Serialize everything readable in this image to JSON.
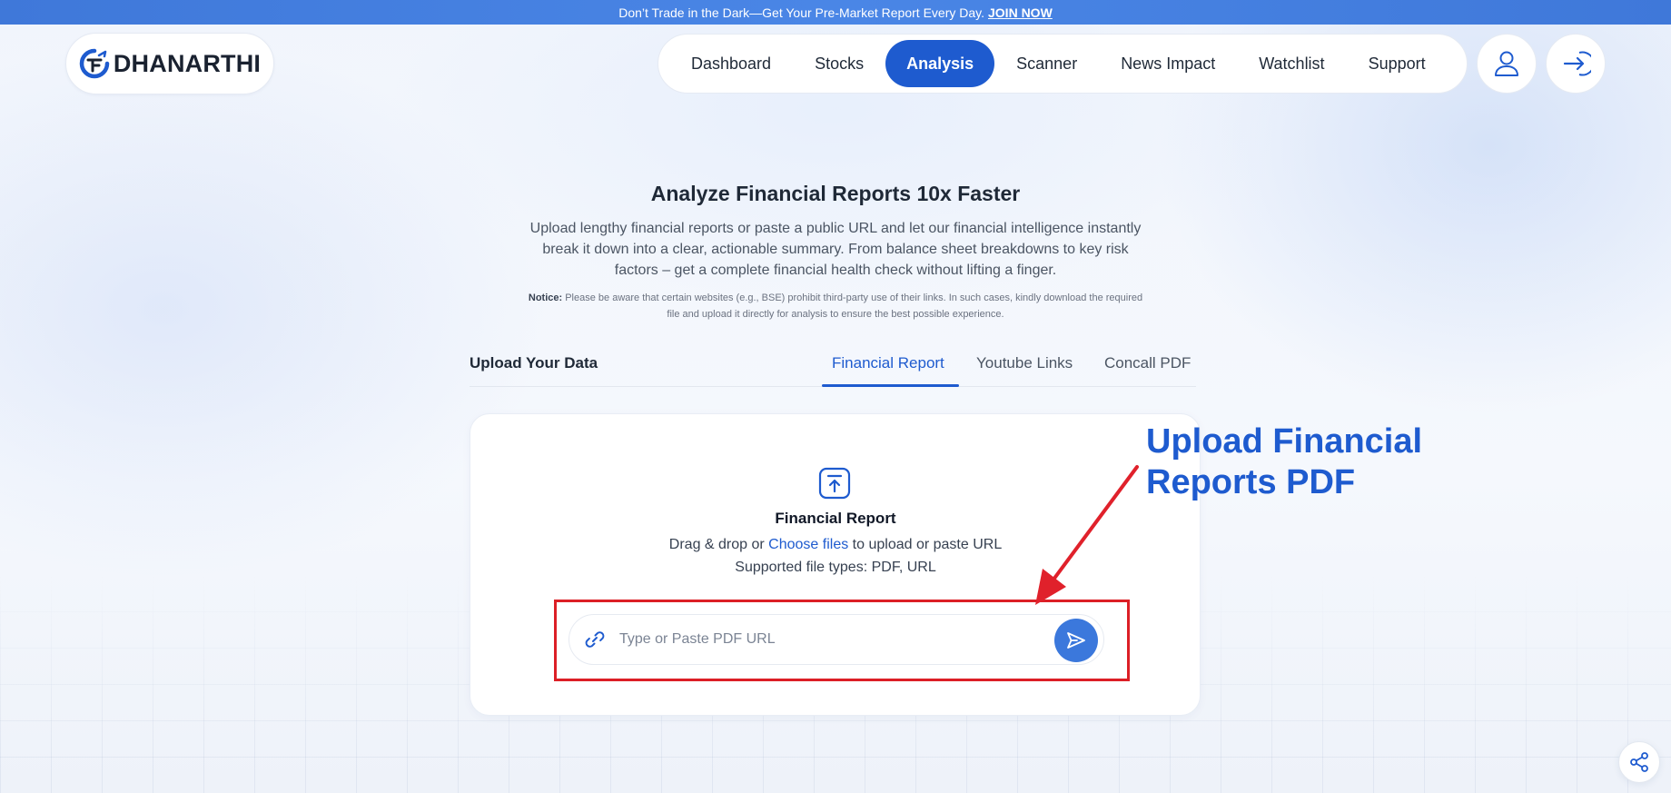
{
  "banner": {
    "text": "Don’t Trade in the Dark—Get Your Pre-Market Report Every Day.",
    "link_label": "JOIN NOW"
  },
  "brand": {
    "logo_text": "DHANARTHI",
    "logo_icon": "dhanarthi-logo-icon"
  },
  "nav": {
    "items": [
      {
        "label": "Dashboard"
      },
      {
        "label": "Stocks"
      },
      {
        "label": "Analysis",
        "active": true
      },
      {
        "label": "Scanner"
      },
      {
        "label": "News Impact"
      },
      {
        "label": "Watchlist"
      },
      {
        "label": "Support"
      }
    ],
    "profile_icon": "user-icon",
    "login_icon": "login-arrow-icon"
  },
  "hero": {
    "title": "Analyze Financial Reports 10x Faster",
    "description": "Upload lengthy financial reports or paste a public URL and let our financial intelligence instantly break it down into a clear, actionable summary. From balance sheet breakdowns to key risk factors – get a complete financial health check without lifting a finger.",
    "notice_label": "Notice:",
    "notice_text": "Please be aware that certain websites (e.g., BSE) prohibit third-party use of their links. In such cases, kindly download the required file and upload it directly for analysis to ensure the best possible experience."
  },
  "upload": {
    "section_label": "Upload Your Data",
    "tabs": [
      {
        "label": "Financial Report",
        "active": true
      },
      {
        "label": "Youtube Links"
      },
      {
        "label": "Concall PDF"
      }
    ],
    "card": {
      "icon": "upload-icon",
      "title": "Financial Report",
      "drag_prefix": "Drag & drop or",
      "choose_link": "Choose files",
      "drag_suffix": "to upload or paste URL",
      "supported": "Supported file types: PDF, URL",
      "url_placeholder": "Type or Paste PDF URL",
      "url_value": ""
    }
  },
  "annotation": {
    "line1": "Upload Financial",
    "line2": "Reports PDF",
    "color": "#1e5bcf"
  },
  "colors": {
    "accent": "#1e5bcf",
    "banner": "#4a86e6",
    "highlight_box": "#dc1f26"
  },
  "share_icon": "share-icon"
}
